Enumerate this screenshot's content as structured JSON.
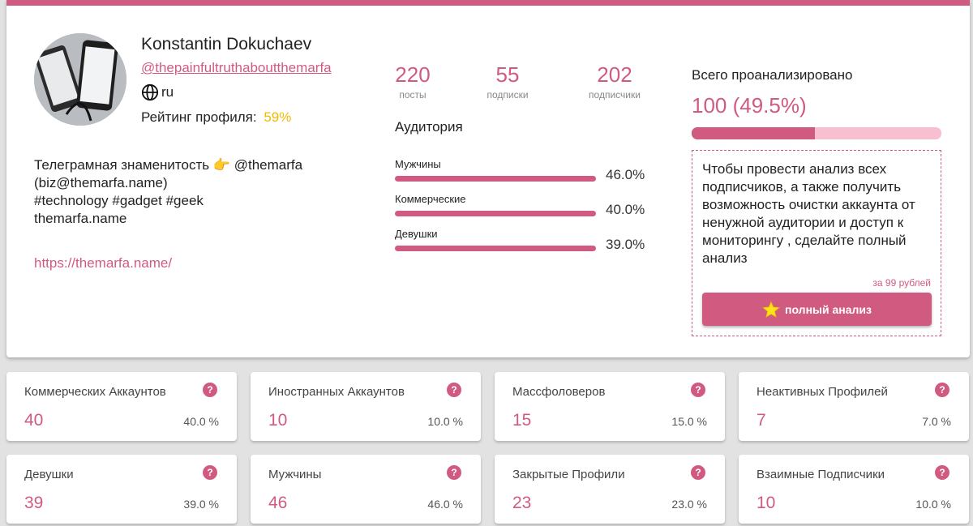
{
  "profile": {
    "name": "Konstantin Dokuchaev",
    "handle": "@thepainfultruthaboutthemarfa",
    "lang": "ru",
    "rating_label": "Рейтинг профиля:",
    "rating_value": "59%",
    "bio": "Телеграмная знаменитость 👉 @themarfa\n(biz@themarfa.name)\n#technology #gadget #geek\nthemarfa.name",
    "site": "https://themarfa.name/"
  },
  "stats": [
    {
      "value": "220",
      "label": "посты"
    },
    {
      "value": "55",
      "label": "подписки"
    },
    {
      "value": "202",
      "label": "подписчики"
    }
  ],
  "audience": {
    "title": "Аудитория",
    "rows": [
      {
        "label": "Мужчины",
        "pct": "46.0%",
        "fraction": 0.46
      },
      {
        "label": "Коммерческие",
        "pct": "40.0%",
        "fraction": 0.4
      },
      {
        "label": "Девушки",
        "pct": "39.0%",
        "fraction": 0.39
      }
    ]
  },
  "analysis": {
    "title": "Всего проанализировано",
    "value": "100 (49.5%)",
    "progress_fraction": 0.495,
    "promo_text": "Чтобы провести анализ всех подписчиков, а также получить возможность очистки аккаунта от ненужной аудитории и доступ к мониторингу , сделайте полный анализ",
    "price": "за 99 рублей",
    "button_label": "полный анализ"
  },
  "tiles": [
    {
      "label": "Коммерческих Аккаунтов",
      "value": "40",
      "pct": "40.0 %"
    },
    {
      "label": "Иностранных Аккаунтов",
      "value": "10",
      "pct": "10.0 %"
    },
    {
      "label": "Массфоловеров",
      "value": "15",
      "pct": "15.0 %"
    },
    {
      "label": "Неактивных Профилей",
      "value": "7",
      "pct": "7.0 %"
    },
    {
      "label": "Девушки",
      "value": "39",
      "pct": "39.0 %"
    },
    {
      "label": "Мужчины",
      "value": "46",
      "pct": "46.0 %"
    },
    {
      "label": "Закрытые Профили",
      "value": "23",
      "pct": "23.0 %"
    },
    {
      "label": "Взаимные Подписчики",
      "value": "10",
      "pct": "10.0 %"
    }
  ],
  "colors": {
    "accent": "#d15b80",
    "accent_light": "#f8bfd0",
    "rating": "#f5b800"
  }
}
